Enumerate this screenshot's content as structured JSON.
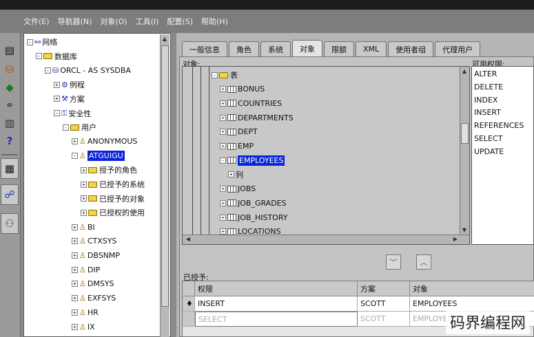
{
  "menu": [
    "文件(E)",
    "导航器(N)",
    "对象(O)",
    "工具(I)",
    "配置(S)",
    "帮助(H)"
  ],
  "toolbar_icons": [
    "properties-icon",
    "database-icon",
    "cube-icon",
    "connect-icon",
    "trash-icon",
    "help-icon",
    "table-icon",
    "network-icon",
    "users-icon"
  ],
  "nav_tree": [
    {
      "label": "网络",
      "depth": 0,
      "toggle": "-",
      "icon": "network-icon"
    },
    {
      "label": "数据库",
      "depth": 1,
      "toggle": "-",
      "icon": "folder-icon"
    },
    {
      "label": "ORCL - AS SYSDBA",
      "depth": 2,
      "toggle": "-",
      "icon": "database-icon"
    },
    {
      "label": "例程",
      "depth": 3,
      "toggle": "+",
      "icon": "instance-icon"
    },
    {
      "label": "方案",
      "depth": 3,
      "toggle": "+",
      "icon": "schema-icon"
    },
    {
      "label": "安全性",
      "depth": 3,
      "toggle": "-",
      "icon": "security-icon"
    },
    {
      "label": "用户",
      "depth": 4,
      "toggle": "-",
      "icon": "folder-icon"
    },
    {
      "label": "ANONYMOUS",
      "depth": 5,
      "toggle": "+",
      "icon": "user-icon"
    },
    {
      "label": "ATGUIGU",
      "depth": 5,
      "toggle": "-",
      "icon": "user-icon",
      "selected": true
    },
    {
      "label": "授予的角色",
      "depth": 6,
      "toggle": "+",
      "icon": "folder-icon"
    },
    {
      "label": "已授予的系统",
      "depth": 6,
      "toggle": "+",
      "icon": "folder-icon"
    },
    {
      "label": "已授予的对象",
      "depth": 6,
      "toggle": "+",
      "icon": "folder-icon"
    },
    {
      "label": "已授权的使用",
      "depth": 6,
      "toggle": "+",
      "icon": "folder-icon"
    },
    {
      "label": "BI",
      "depth": 5,
      "toggle": "+",
      "icon": "user-icon"
    },
    {
      "label": "CTXSYS",
      "depth": 5,
      "toggle": "+",
      "icon": "user-icon"
    },
    {
      "label": "DBSNMP",
      "depth": 5,
      "toggle": "+",
      "icon": "user-icon"
    },
    {
      "label": "DIP",
      "depth": 5,
      "toggle": "+",
      "icon": "user-icon"
    },
    {
      "label": "DMSYS",
      "depth": 5,
      "toggle": "+",
      "icon": "user-icon"
    },
    {
      "label": "EXFSYS",
      "depth": 5,
      "toggle": "+",
      "icon": "user-icon"
    },
    {
      "label": "HR",
      "depth": 5,
      "toggle": "+",
      "icon": "user-icon"
    },
    {
      "label": "IX",
      "depth": 5,
      "toggle": "+",
      "icon": "user-icon"
    }
  ],
  "tabs": [
    {
      "label": "一般信息",
      "active": false
    },
    {
      "label": "角色",
      "active": false
    },
    {
      "label": "系统",
      "active": false
    },
    {
      "label": "对象",
      "active": true
    },
    {
      "label": "限额",
      "active": false
    },
    {
      "label": "XML",
      "active": false
    },
    {
      "label": "使用者组",
      "active": false
    },
    {
      "label": "代理用户",
      "active": false
    }
  ],
  "objects_label": "对象:",
  "available_label": "可用权限:",
  "object_tree": [
    {
      "label": "表",
      "depth": 0,
      "toggle": "-",
      "icon": "folder-icon"
    },
    {
      "label": "BONUS",
      "depth": 1,
      "toggle": "+",
      "icon": "table-icon"
    },
    {
      "label": "COUNTRIES",
      "depth": 1,
      "toggle": "+",
      "icon": "table-icon"
    },
    {
      "label": "DEPARTMENTS",
      "depth": 1,
      "toggle": "+",
      "icon": "table-icon"
    },
    {
      "label": "DEPT",
      "depth": 1,
      "toggle": "+",
      "icon": "table-icon"
    },
    {
      "label": "EMP",
      "depth": 1,
      "toggle": "+",
      "icon": "table-icon"
    },
    {
      "label": "EMPLOYEES",
      "depth": 1,
      "toggle": "-",
      "icon": "table-icon",
      "selected": true
    },
    {
      "label": "列",
      "depth": 2,
      "toggle": "+",
      "icon": "none"
    },
    {
      "label": "JOBS",
      "depth": 1,
      "toggle": "+",
      "icon": "table-icon"
    },
    {
      "label": "JOB_GRADES",
      "depth": 1,
      "toggle": "+",
      "icon": "table-icon"
    },
    {
      "label": "JOB_HISTORY",
      "depth": 1,
      "toggle": "+",
      "icon": "table-icon"
    },
    {
      "label": "LOCATIONS",
      "depth": 1,
      "toggle": "+",
      "icon": "table-icon"
    }
  ],
  "privileges": [
    "ALTER",
    "DELETE",
    "INDEX",
    "INSERT",
    "REFERENCES",
    "SELECT",
    "UPDATE"
  ],
  "move_down_icon": "chevron-down-icon",
  "move_up_icon": "chevron-up-icon",
  "granted_label": "已授予:",
  "granted_columns": [
    "权限",
    "方案",
    "对象"
  ],
  "granted_rows": [
    {
      "privilege": "INSERT",
      "schema": "SCOTT",
      "object": "EMPLOYEES",
      "current": true
    },
    {
      "privilege": "SELECT",
      "schema": "SCOTT",
      "object": "EMPLOYEES",
      "current": false
    }
  ],
  "watermark": "码界编程网"
}
